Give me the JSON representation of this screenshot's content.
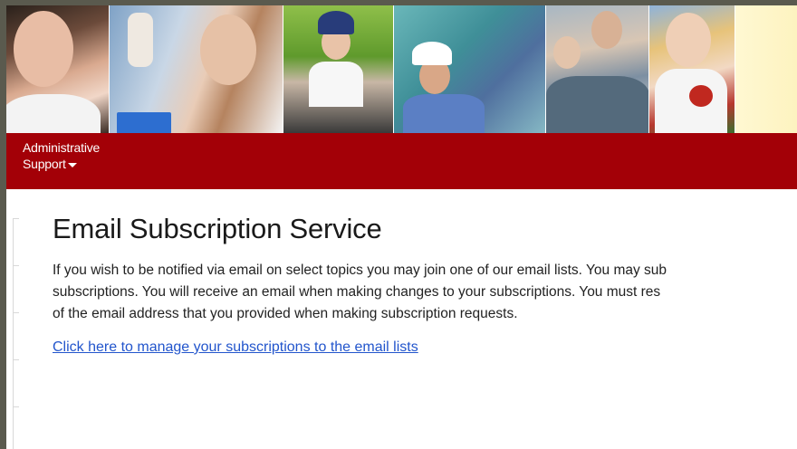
{
  "banner": {
    "photos": [
      {
        "name": "smiling-woman-photo"
      },
      {
        "name": "lab-scientist-photo"
      },
      {
        "name": "cyclist-photo"
      },
      {
        "name": "engineer-hardhat-photo"
      },
      {
        "name": "senior-couple-photo"
      },
      {
        "name": "woman-with-produce-photo"
      }
    ],
    "accent_color": "#a30007"
  },
  "nav": {
    "items": [
      {
        "label_line1": "Administrative",
        "label_line2": "Support",
        "has_dropdown": true,
        "icon": "caret-down-icon"
      }
    ]
  },
  "main": {
    "title": "Email Subscription Service",
    "intro_lines": [
      "If you wish to be notified via email on select topics you may join one of our email lists.  You may sub",
      "subscriptions.  You will receive an email when making changes to your subscriptions.  You must res",
      "of the email address that you provided when making subscription requests."
    ],
    "manage_link": "Click here to manage your subscriptions to the email lists",
    "link_color": "#2255cc"
  }
}
